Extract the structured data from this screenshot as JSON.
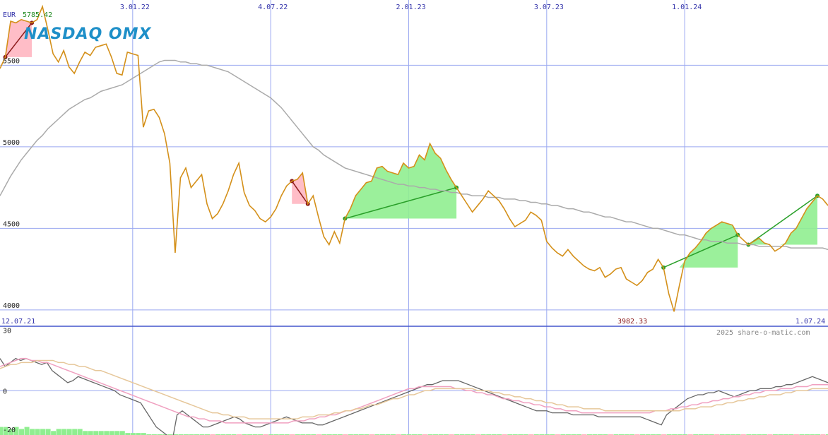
{
  "header": {
    "currency": "EUR",
    "last_value": "5785.42",
    "logo_text": "NASDAQ OMX",
    "min_value": "3982.33",
    "copyright": "2025 share-o-matic.com",
    "start_date": "12.07.21",
    "end_date": "1.07.24"
  },
  "colors": {
    "price": "#d4901a",
    "avg200": "#aaaaaa",
    "grid": "#9aa8f0",
    "up_fill": "#90ee90",
    "down_fill": "#ffb6c1",
    "up_line": "#2aa02a",
    "down_line": "#8b1a1a",
    "osc_main": "#666666",
    "osc_pink": "#f0a0c0",
    "osc_tan": "#e6c79a"
  },
  "chart_data": [
    {
      "type": "line",
      "panel": "price",
      "ylim": [
        3900,
        5900
      ],
      "y_ticks": [
        "5500",
        "5000",
        "4500",
        "4000"
      ],
      "y_tick_values": [
        5500,
        5000,
        4500,
        4000
      ],
      "x_ticks": [
        "3.01.22",
        "4.07.22",
        "2.01.23",
        "3.07.23",
        "1.01.24"
      ],
      "x_tick_positions": [
        25,
        51,
        77,
        103,
        129
      ],
      "x_count": 157,
      "series": [
        {
          "values": [
            5480,
            5550,
            5770,
            5760,
            5780,
            5770,
            5760,
            5780,
            5860,
            5720,
            5570,
            5520,
            5590,
            5490,
            5450,
            5520,
            5580,
            5560,
            5610,
            5620,
            5630,
            5550,
            5450,
            5440,
            5580,
            5570,
            5560,
            5120,
            5220,
            5230,
            5180,
            5080,
            4900,
            4350,
            4810,
            4870,
            4750,
            4790,
            4830,
            4650,
            4560,
            4590,
            4650,
            4730,
            4830,
            4900,
            4720,
            4640,
            4610,
            4560,
            4540,
            4570,
            4620,
            4700,
            4760,
            4790,
            4800,
            4840,
            4650,
            4700,
            4570,
            4450,
            4400,
            4480,
            4410,
            4560,
            4620,
            4700,
            4740,
            4780,
            4790,
            4870,
            4880,
            4850,
            4840,
            4830,
            4900,
            4870,
            4880,
            4950,
            4920,
            5020,
            4960,
            4930,
            4860,
            4800,
            4750,
            4700,
            4650,
            4600,
            4640,
            4680,
            4730,
            4700,
            4670,
            4620,
            4560,
            4510,
            4530,
            4550,
            4600,
            4580,
            4550,
            4420,
            4380,
            4350,
            4330,
            4370,
            4330,
            4300,
            4270,
            4250,
            4240,
            4260,
            4200,
            4220,
            4250,
            4260,
            4190,
            4170,
            4150,
            4180,
            4230,
            4250,
            4310,
            4260,
            4100,
            3990,
            4150,
            4300,
            4350,
            4380,
            4420,
            4470,
            4500,
            4520,
            4540,
            4530,
            4520,
            4460,
            4430,
            4400,
            4420,
            4440,
            4410,
            4400,
            4360,
            4380,
            4410,
            4470,
            4500,
            4560,
            4620,
            4660,
            4700,
            4680,
            4640
          ]
        },
        {
          "name": "",
          "values": [
            4700,
            4760,
            4820,
            4870,
            4920,
            4960,
            5000,
            5040,
            5070,
            5110,
            5140,
            5170,
            5200,
            5230,
            5250,
            5270,
            5290,
            5300,
            5320,
            5340,
            5350,
            5360,
            5370,
            5380,
            5400,
            5420,
            5440,
            5460,
            5480,
            5500,
            5520,
            5530,
            5530,
            5530,
            5520,
            5520,
            5510,
            5510,
            5500,
            5500,
            5490,
            5480,
            5470,
            5460,
            5440,
            5420,
            5400,
            5380,
            5360,
            5340,
            5320,
            5300,
            5270,
            5240,
            5200,
            5160,
            5120,
            5080,
            5040,
            5000,
            4980,
            4950,
            4930,
            4910,
            4890,
            4870,
            4860,
            4850,
            4840,
            4830,
            4820,
            4810,
            4800,
            4790,
            4780,
            4770,
            4770,
            4760,
            4760,
            4750,
            4750,
            4740,
            4740,
            4730,
            4730,
            4720,
            4720,
            4710,
            4710,
            4700,
            4700,
            4700,
            4690,
            4690,
            4690,
            4680,
            4680,
            4680,
            4670,
            4670,
            4660,
            4660,
            4650,
            4650,
            4640,
            4640,
            4630,
            4620,
            4620,
            4610,
            4600,
            4600,
            4590,
            4580,
            4570,
            4570,
            4560,
            4550,
            4540,
            4540,
            4530,
            4520,
            4510,
            4500,
            4500,
            4490,
            4480,
            4470,
            4460,
            4460,
            4450,
            4440,
            4430,
            4430,
            4420,
            4420,
            4420,
            4410,
            4410,
            4410,
            4400,
            4400,
            4400,
            4390,
            4390,
            4390,
            4390,
            4390,
            4390,
            4380,
            4380,
            4380,
            4380,
            4380,
            4380,
            4380,
            4370
          ]
        }
      ],
      "up_trends": [
        {
          "from_index": 65,
          "to_index": 86
        },
        {
          "from_index": 125,
          "to_index": 139
        },
        {
          "from_index": 141,
          "to_index": 154
        }
      ],
      "down_trends": [
        {
          "from_index": 1,
          "to_index": 6
        },
        {
          "from_index": 55,
          "to_index": 58
        }
      ]
    },
    {
      "type": "line",
      "panel": "oscillator",
      "ylim": [
        -22,
        32
      ],
      "y_ticks": [
        "30",
        "0",
        "-20"
      ],
      "y_tick_values": [
        30,
        0,
        -20
      ],
      "series": [
        {
          "values": [
            16,
            12,
            14,
            16,
            15,
            16,
            15,
            14,
            13,
            14,
            10,
            8,
            6,
            4,
            5,
            7,
            6,
            5,
            4,
            3,
            2,
            1,
            0,
            -2,
            -3,
            -4,
            -5,
            -6,
            -10,
            -14,
            -18,
            -20,
            -22,
            -26,
            -12,
            -10,
            -12,
            -14,
            -16,
            -18,
            -18,
            -17,
            -16,
            -15,
            -14,
            -13,
            -14,
            -16,
            -17,
            -18,
            -18,
            -17,
            -16,
            -15,
            -14,
            -13,
            -14,
            -15,
            -16,
            -16,
            -16,
            -17,
            -17,
            -16,
            -15,
            -14,
            -13,
            -12,
            -11,
            -10,
            -9,
            -8,
            -7,
            -6,
            -5,
            -4,
            -3,
            -2,
            -1,
            0,
            1,
            2,
            3,
            3,
            4,
            5,
            5,
            5,
            5,
            4,
            3,
            2,
            1,
            0,
            -1,
            -2,
            -3,
            -4,
            -5,
            -6,
            -7,
            -8,
            -9,
            -10,
            -10,
            -10,
            -11,
            -11,
            -11,
            -11,
            -12,
            -12,
            -12,
            -12,
            -12,
            -13,
            -13,
            -13,
            -13,
            -13,
            -13,
            -13,
            -13,
            -13,
            -14,
            -15,
            -16,
            -17,
            -12,
            -10,
            -8,
            -6,
            -4,
            -3,
            -2,
            -2,
            -1,
            -1,
            0,
            -1,
            -2,
            -3,
            -2,
            -1,
            0,
            0,
            1,
            1,
            1,
            2,
            2,
            3,
            3,
            4,
            5,
            6,
            7,
            6,
            5,
            4
          ]
        },
        {
          "values": [
            12,
            13,
            14,
            15,
            16,
            16,
            15,
            15,
            14,
            14,
            13,
            12,
            11,
            10,
            9,
            8,
            7,
            6,
            5,
            4,
            3,
            2,
            1,
            0,
            -1,
            -2,
            -3,
            -4,
            -5,
            -6,
            -7,
            -8,
            -9,
            -10,
            -11,
            -12,
            -13,
            -13,
            -14,
            -14,
            -15,
            -15,
            -15,
            -16,
            -16,
            -16,
            -16,
            -16,
            -16,
            -16,
            -16,
            -16,
            -16,
            -16,
            -16,
            -16,
            -15,
            -15,
            -15,
            -14,
            -14,
            -13,
            -13,
            -12,
            -12,
            -11,
            -10,
            -10,
            -9,
            -8,
            -7,
            -6,
            -5,
            -4,
            -3,
            -2,
            -1,
            0,
            1,
            1,
            2,
            2,
            2,
            2,
            2,
            2,
            2,
            1,
            1,
            0,
            0,
            -1,
            -1,
            -2,
            -2,
            -3,
            -4,
            -4,
            -5,
            -5,
            -6,
            -6,
            -7,
            -7,
            -8,
            -8,
            -9,
            -9,
            -10,
            -10,
            -10,
            -11,
            -11,
            -11,
            -11,
            -11,
            -11,
            -11,
            -11,
            -11,
            -11,
            -11,
            -11,
            -11,
            -11,
            -10,
            -10,
            -10,
            -9,
            -9,
            -8,
            -8,
            -7,
            -7,
            -6,
            -6,
            -5,
            -5,
            -4,
            -4,
            -3,
            -3,
            -2,
            -2,
            -1,
            -1,
            0,
            0,
            0,
            1,
            1,
            1,
            2,
            2,
            2,
            3,
            3,
            3,
            3
          ]
        },
        {
          "values": [
            11,
            12,
            13,
            13,
            14,
            14,
            14,
            15,
            15,
            15,
            15,
            14,
            14,
            13,
            13,
            12,
            12,
            11,
            10,
            10,
            9,
            8,
            7,
            6,
            5,
            4,
            3,
            2,
            1,
            0,
            -1,
            -2,
            -3,
            -4,
            -5,
            -6,
            -7,
            -8,
            -9,
            -10,
            -11,
            -11,
            -12,
            -12,
            -13,
            -13,
            -13,
            -14,
            -14,
            -14,
            -14,
            -14,
            -14,
            -14,
            -14,
            -14,
            -14,
            -13,
            -13,
            -13,
            -12,
            -12,
            -12,
            -11,
            -11,
            -10,
            -10,
            -9,
            -9,
            -8,
            -7,
            -7,
            -6,
            -5,
            -4,
            -4,
            -3,
            -2,
            -2,
            -1,
            0,
            0,
            1,
            1,
            1,
            1,
            1,
            1,
            1,
            1,
            0,
            0,
            0,
            -1,
            -1,
            -2,
            -2,
            -3,
            -3,
            -4,
            -4,
            -5,
            -5,
            -6,
            -6,
            -7,
            -7,
            -8,
            -8,
            -8,
            -9,
            -9,
            -9,
            -9,
            -10,
            -10,
            -10,
            -10,
            -10,
            -10,
            -10,
            -10,
            -10,
            -10,
            -10,
            -10,
            -10,
            -10,
            -10,
            -9,
            -9,
            -9,
            -8,
            -8,
            -8,
            -7,
            -7,
            -6,
            -6,
            -5,
            -5,
            -4,
            -4,
            -3,
            -3,
            -2,
            -2,
            -2,
            -1,
            -1,
            0,
            0,
            0,
            1,
            1,
            1,
            1
          ]
        }
      ],
      "volume": [
        -18,
        -18,
        -19,
        -18,
        -19,
        -18,
        -19,
        -19,
        -19,
        -19,
        -20,
        -19,
        -19,
        -19,
        -19,
        -19,
        -20,
        -20,
        -20,
        -20,
        -20,
        -20,
        -20,
        -20,
        -21,
        -21,
        -21,
        -21,
        -22,
        -22,
        -22,
        -22,
        -22,
        -23,
        -22,
        -22,
        -22,
        -22,
        -22,
        -22,
        -22,
        -22,
        -22,
        -22,
        -22,
        -22,
        -22,
        -22,
        -22,
        -22,
        -22,
        -22,
        -22,
        -22,
        -22,
        -22,
        -22,
        -22,
        -22,
        -22,
        -22,
        -22,
        -22,
        -22,
        -22,
        -22,
        -22,
        -22,
        -22,
        -22,
        -22,
        -22,
        -22,
        -22,
        -22,
        -22,
        -22,
        -22,
        -22,
        -22,
        -22,
        -22,
        -22,
        -22,
        -22,
        -22,
        -22,
        -22,
        -22,
        -22,
        -22,
        -22,
        -22,
        -22,
        -22,
        -22,
        -22,
        -22,
        -22,
        -22,
        -22,
        -22,
        -22,
        -22,
        -22,
        -22,
        -22,
        -22,
        -22,
        -22,
        -22,
        -22,
        -22,
        -22,
        -22,
        -22,
        -22,
        -22,
        -22,
        -22,
        -22,
        -22,
        -22,
        -22,
        -22,
        -22,
        -22,
        -22,
        -22,
        -22,
        -22,
        -22,
        -22,
        -22,
        -22,
        -22,
        -22,
        -22,
        -22,
        -22,
        -22,
        -22,
        -22,
        -22,
        -22,
        -22,
        -22,
        -22,
        -22,
        -22,
        -22,
        -22,
        -22,
        -22,
        -22,
        -22,
        -22
      ]
    }
  ]
}
